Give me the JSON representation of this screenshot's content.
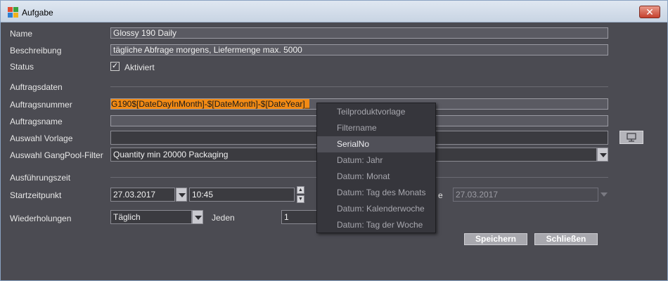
{
  "window": {
    "title": "Aufgabe",
    "close_label": "✕"
  },
  "form": {
    "name_label": "Name",
    "name_value": "Glossy 190 Daily",
    "beschreibung_label": "Beschreibung",
    "beschreibung_value": "tägliche Abfrage morgens, Liefermenge max. 5000",
    "status_label": "Status",
    "status_check": "✓",
    "status_value": "Aktiviert",
    "auftragsdaten_section": "Auftragsdaten",
    "auftragsnummer_label": "Auftragsnummer",
    "auftragsnummer_value": "G190$[DateDayInMonth]-$[DateMonth]-$[DateYear]_",
    "auftragsname_label": "Auftragsname",
    "auftragsname_value": "",
    "vorlage_label": "Auswahl Vorlage",
    "vorlage_value": "",
    "gangpool_label": "Auswahl GangPool-Filter",
    "gangpool_value": "Quantity min 20000 Packaging",
    "ausfuehrung_section": "Ausführungszeit",
    "startzeitpunkt_label": "Startzeitpunkt",
    "start_date": "27.03.2017",
    "start_time": "10:45",
    "end_label_fragment": "e",
    "end_date": "27.03.2017",
    "wiederholungen_label": "Wiederholungen",
    "wiederholungen_value": "Täglich",
    "jeden_label": "Jeden",
    "jeden_value": "1"
  },
  "buttons": {
    "save": "Speichern",
    "close": "Schließen"
  },
  "popup": {
    "selected_index": 2,
    "items": [
      "Teilproduktvorlage",
      "Filtername",
      "SerialNo",
      "Datum: Jahr",
      "Datum: Monat",
      "Datum: Tag des Monats",
      "Datum: Kalenderwoche",
      "Datum: Tag der Woche"
    ]
  },
  "colors": {
    "background": "#4b4b52",
    "highlight": "#f28a14",
    "popup": "#36363c"
  }
}
